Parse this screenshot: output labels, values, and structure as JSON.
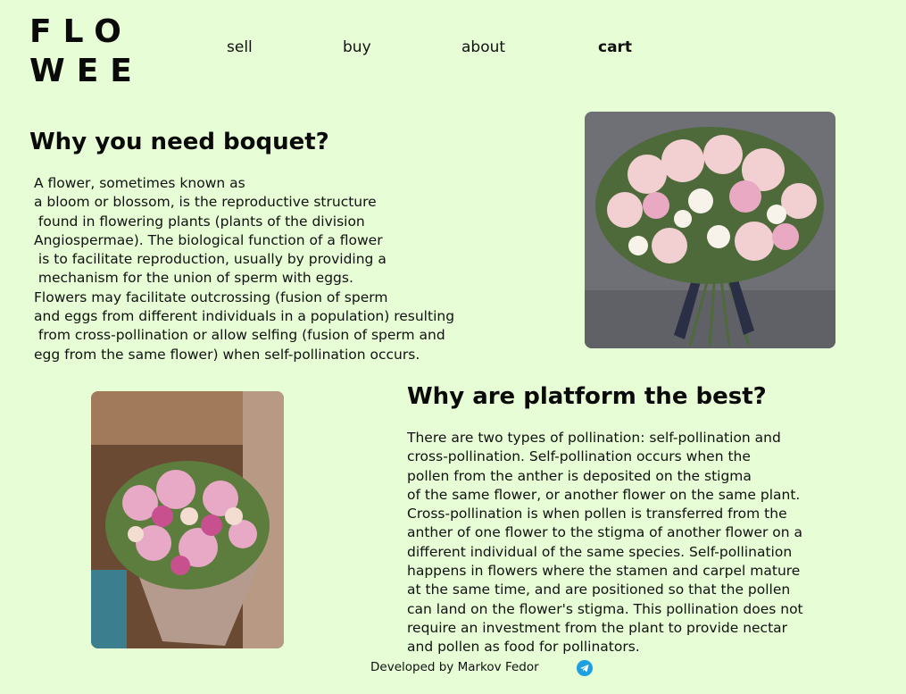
{
  "logo": {
    "line1": "FLO",
    "line2": "WEE"
  },
  "nav": {
    "sell": "sell",
    "buy": "buy",
    "about": "about",
    "cart": "cart"
  },
  "section1": {
    "title": "Why you need boquet?",
    "body": "A flower, sometimes known as\na bloom or blossom, is the reproductive structure\n found in flowering plants (plants of the division\nAngiospermae). The biological function of a flower\n is to facilitate reproduction, usually by providing a\n mechanism for the union of sperm with eggs.\nFlowers may facilitate outcrossing (fusion of sperm\nand eggs from different individuals in a population) resulting\n from cross-pollination or allow selfing (fusion of sperm and\negg from the same flower) when self-pollination occurs."
  },
  "section2": {
    "title": "Why are platform the best?",
    "body": "There are two types of pollination: self-pollination and\ncross-pollination. Self-pollination occurs when the\npollen from the anther is deposited on the stigma\nof the same flower, or another flower on the same plant.\nCross-pollination is when pollen is transferred from the\nanther of one flower to the stigma of another flower on a\ndifferent individual of the same species. Self-pollination\nhappens in flowers where the stamen and carpel mature\nat the same time, and are positioned so that the pollen\ncan land on the flower's stigma. This pollination does not\nrequire an investment from the plant to provide nectar\nand pollen as food for pollinators."
  },
  "footer": {
    "credit": "Developed by Markov Fedor",
    "icon": "telegram-icon"
  },
  "colors": {
    "background": "#e6fdd5",
    "text": "#111111",
    "telegram": "#1e9fe0"
  }
}
